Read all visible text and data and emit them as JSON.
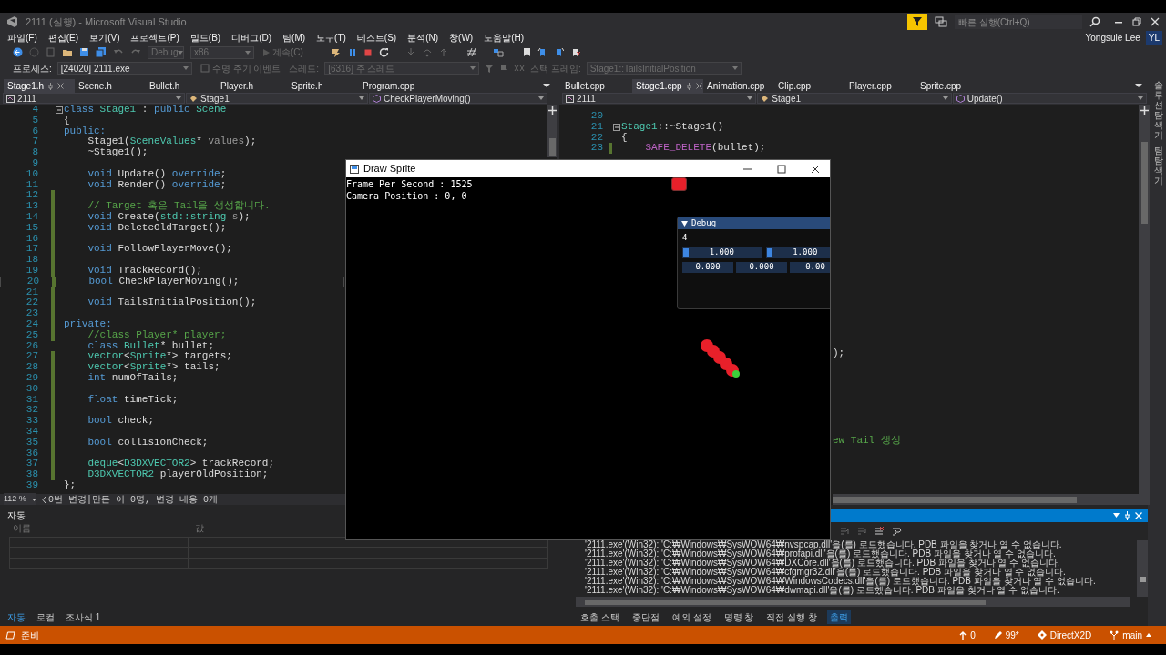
{
  "title_bar": {
    "title": "2111 (실행) - Microsoft Visual Studio",
    "quick_launch_placeholder": "빠른 실행(Ctrl+Q)",
    "user_name": "Yongsule Lee",
    "user_initials": "YL"
  },
  "menu": [
    "파일(F)",
    "편집(E)",
    "보기(V)",
    "프로젝트(P)",
    "빌드(B)",
    "디버그(D)",
    "팀(M)",
    "도구(T)",
    "테스트(S)",
    "분석(N)",
    "창(W)",
    "도움말(H)"
  ],
  "toolbar": {
    "configuration": {
      "text": "Debug",
      "disabled": true
    },
    "platform": {
      "text": "x86",
      "disabled": true
    },
    "continue": {
      "text": "계속(C)",
      "disabled": true
    }
  },
  "debug_location": {
    "process_label": "프로세스:",
    "process": "[24020] 2111.exe",
    "lifecycle_events": {
      "text": "수명 주기 이벤트",
      "disabled": true
    },
    "thread_label": "스레드:",
    "thread": {
      "text": "[6316] 주 스레드",
      "disabled": true
    },
    "stack_frame_label": "스택 프레임:",
    "stack_frame": {
      "text": "Stage1::TailsInitialPosition",
      "disabled": true
    }
  },
  "left_editor": {
    "tabs": [
      {
        "label": "Stage1.h",
        "selected": true
      },
      {
        "label": "Scene.h",
        "selected": false
      },
      {
        "label": "Bullet.h",
        "selected": false
      },
      {
        "label": "Player.h",
        "selected": false
      },
      {
        "label": "Sprite.h",
        "selected": false
      },
      {
        "label": "Program.cpp",
        "selected": false
      }
    ],
    "nav": {
      "project": "2111",
      "scope": "Stage1",
      "member": "CheckPlayerMoving()"
    },
    "lines": [
      {
        "number": "4",
        "changed": false,
        "current": false,
        "fold": true,
        "tokens": [
          {
            "kind": "keyword",
            "text": "class"
          },
          {
            "kind": "type",
            "text": " Stage1"
          },
          {
            "kind": "plain",
            "text": " : "
          },
          {
            "kind": "keyword",
            "text": "public"
          },
          {
            "kind": "type",
            "text": " Scene"
          }
        ]
      },
      {
        "number": "5",
        "changed": false,
        "current": false,
        "fold": false,
        "tokens": [
          {
            "kind": "plain",
            "text": "{"
          }
        ]
      },
      {
        "number": "6",
        "changed": false,
        "current": false,
        "fold": false,
        "tokens": [
          {
            "kind": "keyword",
            "text": "public:"
          }
        ]
      },
      {
        "number": "7",
        "changed": false,
        "current": false,
        "fold": false,
        "tokens": [
          {
            "kind": "plain",
            "text": "    Stage1("
          },
          {
            "kind": "type",
            "text": "SceneValues"
          },
          {
            "kind": "plain",
            "text": "* "
          },
          {
            "kind": "param",
            "text": "values"
          },
          {
            "kind": "plain",
            "text": ");"
          }
        ]
      },
      {
        "number": "8",
        "changed": false,
        "current": false,
        "fold": false,
        "tokens": [
          {
            "kind": "plain",
            "text": "    ~Stage1();"
          }
        ]
      },
      {
        "number": "9",
        "changed": false,
        "current": false,
        "fold": false
      },
      {
        "number": "10",
        "changed": false,
        "current": false,
        "fold": false,
        "tokens": [
          {
            "kind": "keyword",
            "text": "    void"
          },
          {
            "kind": "plain",
            "text": " Update() "
          },
          {
            "kind": "keyword",
            "text": "override"
          },
          {
            "kind": "plain",
            "text": ";"
          }
        ]
      },
      {
        "number": "11",
        "changed": false,
        "current": false,
        "fold": false,
        "tokens": [
          {
            "kind": "keyword",
            "text": "    void"
          },
          {
            "kind": "plain",
            "text": " Render() "
          },
          {
            "kind": "keyword",
            "text": "override"
          },
          {
            "kind": "plain",
            "text": ";"
          }
        ]
      },
      {
        "number": "12",
        "changed": true,
        "current": false,
        "fold": false
      },
      {
        "number": "13",
        "changed": true,
        "current": false,
        "fold": false,
        "tokens": [
          {
            "kind": "comment",
            "text": "    // Target 혹은 Tail을 생성합니다."
          }
        ]
      },
      {
        "number": "14",
        "changed": true,
        "current": false,
        "fold": false,
        "tokens": [
          {
            "kind": "keyword",
            "text": "    void"
          },
          {
            "kind": "plain",
            "text": " Create("
          },
          {
            "kind": "type",
            "text": "std::string "
          },
          {
            "kind": "param",
            "text": "s"
          },
          {
            "kind": "plain",
            "text": ");"
          }
        ]
      },
      {
        "number": "15",
        "changed": true,
        "current": false,
        "fold": false,
        "tokens": [
          {
            "kind": "keyword",
            "text": "    void"
          },
          {
            "kind": "plain",
            "text": " DeleteOldTarget();"
          }
        ]
      },
      {
        "number": "16",
        "changed": true,
        "current": false,
        "fold": false
      },
      {
        "number": "17",
        "changed": true,
        "current": false,
        "fold": false,
        "tokens": [
          {
            "kind": "keyword",
            "text": "    void"
          },
          {
            "kind": "plain",
            "text": " FollowPlayerMove();"
          }
        ]
      },
      {
        "number": "18",
        "changed": true,
        "current": false,
        "fold": false
      },
      {
        "number": "19",
        "changed": true,
        "current": false,
        "fold": false,
        "tokens": [
          {
            "kind": "keyword",
            "text": "    void"
          },
          {
            "kind": "plain",
            "text": " TrackRecord();"
          }
        ]
      },
      {
        "number": "20",
        "changed": true,
        "current": true,
        "fold": false,
        "tokens": [
          {
            "kind": "keyword",
            "text": "    bool"
          },
          {
            "kind": "plain",
            "text": " CheckPlayerMoving();"
          }
        ]
      },
      {
        "number": "21",
        "changed": true,
        "current": false,
        "fold": false
      },
      {
        "number": "22",
        "changed": true,
        "current": false,
        "fold": false,
        "tokens": [
          {
            "kind": "keyword",
            "text": "    void"
          },
          {
            "kind": "plain",
            "text": " TailsInitialPosition();"
          }
        ]
      },
      {
        "number": "23",
        "changed": true,
        "current": false,
        "fold": false
      },
      {
        "number": "24",
        "changed": true,
        "current": false,
        "fold": false,
        "tokens": [
          {
            "kind": "keyword",
            "text": "private:"
          }
        ]
      },
      {
        "number": "25",
        "changed": true,
        "current": false,
        "fold": false,
        "tokens": [
          {
            "kind": "comment",
            "text": "    //class Player* player;"
          }
        ]
      },
      {
        "number": "26",
        "changed": false,
        "current": false,
        "fold": false,
        "tokens": [
          {
            "kind": "keyword",
            "text": "    class"
          },
          {
            "kind": "type",
            "text": " Bullet"
          },
          {
            "kind": "plain",
            "text": "* bullet;"
          }
        ]
      },
      {
        "number": "27",
        "changed": true,
        "current": false,
        "fold": false,
        "tokens": [
          {
            "kind": "type",
            "text": "    vector"
          },
          {
            "kind": "plain",
            "text": "<"
          },
          {
            "kind": "type",
            "text": "Sprite"
          },
          {
            "kind": "plain",
            "text": "*> targets;"
          }
        ]
      },
      {
        "number": "28",
        "changed": true,
        "current": false,
        "fold": false,
        "tokens": [
          {
            "kind": "type",
            "text": "    vector"
          },
          {
            "kind": "plain",
            "text": "<"
          },
          {
            "kind": "type",
            "text": "Sprite"
          },
          {
            "kind": "plain",
            "text": "*> tails;"
          }
        ]
      },
      {
        "number": "29",
        "changed": true,
        "current": false,
        "fold": false,
        "tokens": [
          {
            "kind": "keyword",
            "text": "    int"
          },
          {
            "kind": "plain",
            "text": " numOfTails;"
          }
        ]
      },
      {
        "number": "30",
        "changed": true,
        "current": false,
        "fold": false
      },
      {
        "number": "31",
        "changed": true,
        "current": false,
        "fold": false,
        "tokens": [
          {
            "kind": "keyword",
            "text": "    float"
          },
          {
            "kind": "plain",
            "text": " timeTick;"
          }
        ]
      },
      {
        "number": "32",
        "changed": true,
        "current": false,
        "fold": false
      },
      {
        "number": "33",
        "changed": true,
        "current": false,
        "fold": false,
        "tokens": [
          {
            "kind": "keyword",
            "text": "    bool"
          },
          {
            "kind": "plain",
            "text": " check;"
          }
        ]
      },
      {
        "number": "34",
        "changed": true,
        "current": false,
        "fold": false
      },
      {
        "number": "35",
        "changed": true,
        "current": false,
        "fold": false,
        "tokens": [
          {
            "kind": "keyword",
            "text": "    bool"
          },
          {
            "kind": "plain",
            "text": " collisionCheck;"
          }
        ]
      },
      {
        "number": "36",
        "changed": true,
        "current": false,
        "fold": false
      },
      {
        "number": "37",
        "changed": true,
        "current": false,
        "fold": false,
        "tokens": [
          {
            "kind": "type",
            "text": "    deque"
          },
          {
            "kind": "plain",
            "text": "<"
          },
          {
            "kind": "type",
            "text": "D3DXVECTOR2"
          },
          {
            "kind": "plain",
            "text": "> trackRecord;"
          }
        ]
      },
      {
        "number": "38",
        "changed": true,
        "current": false,
        "fold": false,
        "tokens": [
          {
            "kind": "type",
            "text": "    D3DXVECTOR2"
          },
          {
            "kind": "plain",
            "text": " playerOldPosition;"
          }
        ]
      },
      {
        "number": "39",
        "changed": false,
        "current": false,
        "fold": false,
        "tokens": [
          {
            "kind": "plain",
            "text": "};"
          }
        ]
      }
    ],
    "zoom": "112 %",
    "changes": "0번 변경|만든 이 0명, 변경 내용 0개"
  },
  "right_editor": {
    "tabs": [
      {
        "label": "Bullet.cpp",
        "selected": false
      },
      {
        "label": "Stage1.cpp",
        "selected": true
      },
      {
        "label": "Animation.cpp",
        "selected": false
      },
      {
        "label": "Clip.cpp",
        "selected": false
      },
      {
        "label": "Player.cpp",
        "selected": false
      },
      {
        "label": "Sprite.cpp",
        "selected": false
      }
    ],
    "nav": {
      "project": "2111",
      "scope": "Stage1",
      "member": "Update()"
    },
    "lines": [
      {
        "number": "20",
        "changed": false,
        "current": false,
        "fold": false
      },
      {
        "number": "21",
        "changed": false,
        "current": false,
        "fold": true,
        "tokens": [
          {
            "kind": "type",
            "text": "Stage1"
          },
          {
            "kind": "plain",
            "text": "::~Stage1()"
          }
        ]
      },
      {
        "number": "22",
        "changed": false,
        "current": false,
        "fold": false,
        "tokens": [
          {
            "kind": "plain",
            "text": "{"
          }
        ]
      },
      {
        "number": "23",
        "changed": true,
        "current": false,
        "fold": false,
        "tokens": [
          {
            "kind": "macro",
            "text": "    SAFE_DELETE"
          },
          {
            "kind": "plain",
            "text": "(bullet);"
          }
        ]
      }
    ],
    "partly_hidden_code": [
      {
        "kind": "plain",
        "text": ");"
      },
      {
        "kind": "comment",
        "text": "ew Tail 생성"
      }
    ]
  },
  "tool_strip": [
    "솔루션 탐색기",
    "팀 탐색기"
  ],
  "game_window": {
    "title": "Draw Sprite",
    "stats": [
      "Frame Per Second : 1525",
      "Camera Position : 0, 0"
    ],
    "debug_panel": {
      "title": "Debug",
      "value": "4",
      "sliders": [
        {
          "text": "1.000",
          "level": 0
        },
        {
          "text": "1.000",
          "level": 0
        }
      ],
      "fields": [
        "0.000",
        "0.000",
        "0.00"
      ]
    }
  },
  "autos_panel": {
    "title": "자동",
    "columns": [
      "이름",
      "값"
    ],
    "tabs": [
      {
        "label": "자동",
        "selected": true
      },
      {
        "label": "로컬",
        "selected": false
      },
      {
        "label": "조사식 1",
        "selected": false
      }
    ]
  },
  "output_panel": {
    "lines": [
      "'2111.exe'(Win32): 'C:₩Windows₩SysWOW64₩nvspcap.dll'을(를) 로드했습니다. PDB 파일을 찾거나 열 수 없습니다.",
      "'2111.exe'(Win32): 'C:₩Windows₩SysWOW64₩profapi.dll'을(를) 로드했습니다. PDB 파일을 찾거나 열 수 없습니다.",
      "'2111.exe'(Win32): 'C:₩Windows₩SysWOW64₩DXCore.dll'을(를) 로드했습니다. PDB 파일을 찾거나 열 수 없습니다.",
      "'2111.exe'(Win32): 'C:₩Windows₩SysWOW64₩cfgmgr32.dll'을(를) 로드했습니다. PDB 파일을 찾거나 열 수 없습니다.",
      "'2111.exe'(Win32): 'C:₩Windows₩SysWOW64₩WindowsCodecs.dll'을(를) 로드했습니다. PDB 파일을 찾거나 열 수 없습니다.",
      "'2111.exe'(Win32): 'C:₩Windows₩SysWOW64₩dwmapi.dll'을(를) 로드했습니다. PDB 파일을 찾거나 열 수 없습니다."
    ],
    "tabs": [
      {
        "label": "호출 스택",
        "selected": false
      },
      {
        "label": "중단점",
        "selected": false
      },
      {
        "label": "예외 설정",
        "selected": false
      },
      {
        "label": "명령 창",
        "selected": false
      },
      {
        "label": "직접 실행 창",
        "selected": false
      },
      {
        "label": "출력",
        "selected": true
      }
    ]
  },
  "status_bar": {
    "text": "준비",
    "up_count": "0",
    "edits": "99*",
    "repository": "DirectX2D",
    "branch": "main"
  }
}
